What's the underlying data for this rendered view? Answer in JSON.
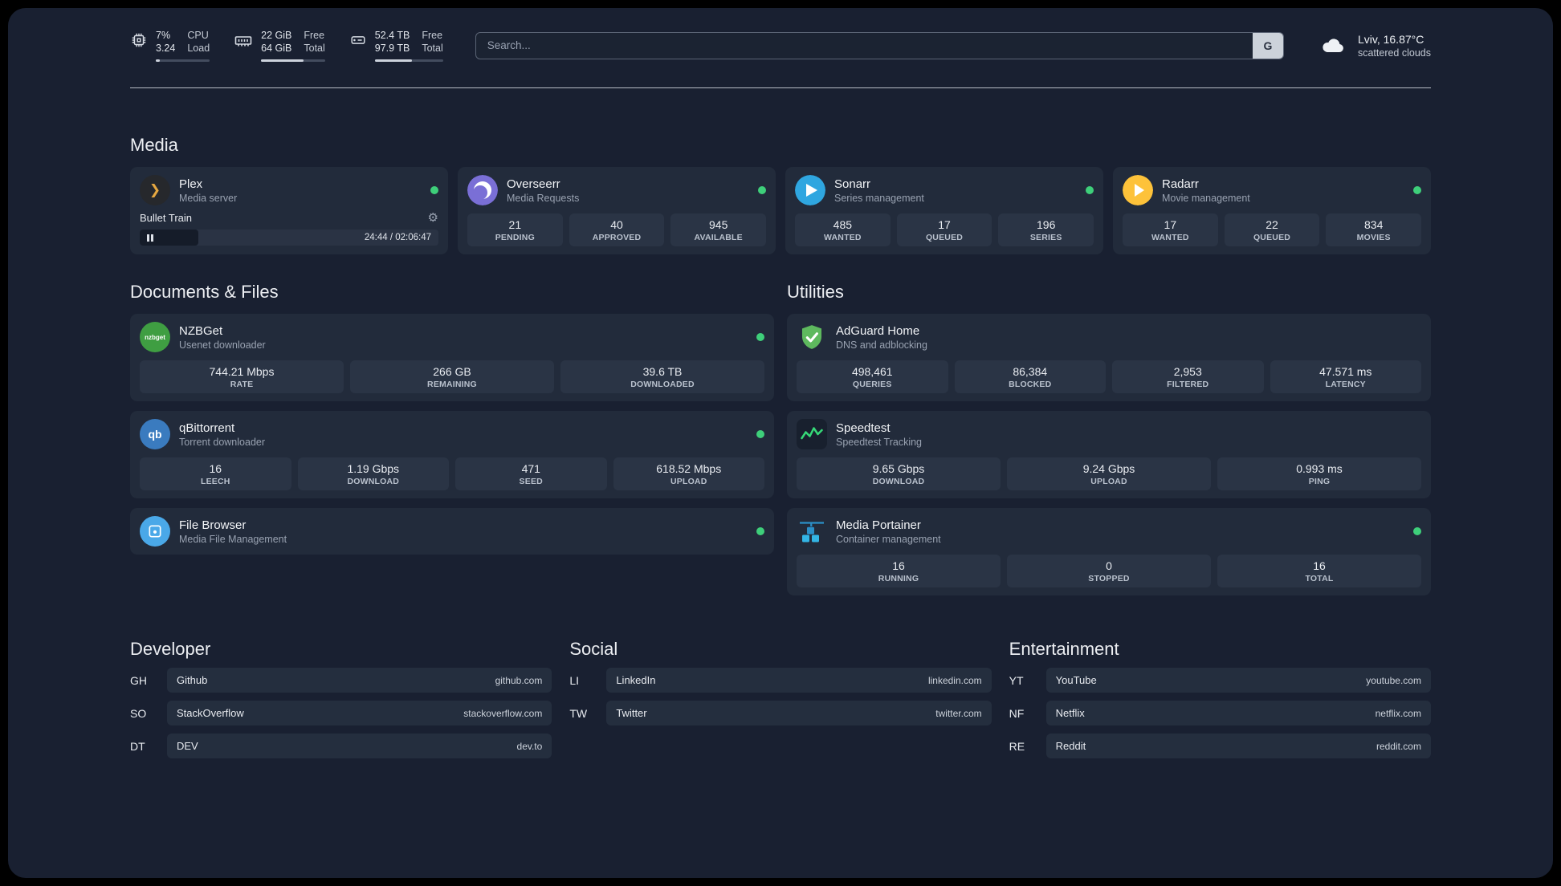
{
  "colors": {
    "status_online": "#3ecf7a",
    "accent_plex": "#e6a841",
    "accent_overseerr": "#7a6fd6",
    "accent_sonarr": "#2fa6e0",
    "accent_radarr": "#fdc23a",
    "accent_nzbget": "#3f9e42",
    "accent_adguard": "#5eb95e",
    "accent_qbittorrent": "#3a7bbf",
    "accent_speedtest": "#36d978",
    "accent_filebrowser": "#4aa8e8",
    "accent_portainer": "#33b5e5"
  },
  "icons": {
    "cpu": "cpu-chip",
    "ram": "memory-stick",
    "disk": "hard-drive",
    "weather": "cloud",
    "gear": "⚙",
    "plex_glyph": "❯",
    "status": "●"
  },
  "topbar": {
    "cpu": {
      "percent": "7%",
      "load": "3.24",
      "label_top": "CPU",
      "label_bottom": "Load",
      "bar_percent": 8
    },
    "ram": {
      "free": "22 GiB",
      "total": "64 GiB",
      "label_top": "Free",
      "label_bottom": "Total",
      "bar_percent": 66
    },
    "disk": {
      "free": "52.4 TB",
      "total": "97.9 TB",
      "label_top": "Free",
      "label_bottom": "Total",
      "bar_percent": 54
    },
    "search": {
      "placeholder": "Search...",
      "button": "G"
    },
    "weather": {
      "location": "Lviv, 16.87°C",
      "condition": "scattered clouds"
    }
  },
  "media": {
    "title": "Media",
    "plex": {
      "name": "Plex",
      "desc": "Media server",
      "player": {
        "title": "Bullet Train",
        "time": "24:44 / 02:06:47",
        "progress_percent": 19.5
      }
    },
    "overseerr": {
      "name": "Overseerr",
      "desc": "Media Requests",
      "stats": [
        {
          "value": "21",
          "label": "PENDING"
        },
        {
          "value": "40",
          "label": "APPROVED"
        },
        {
          "value": "945",
          "label": "AVAILABLE"
        }
      ]
    },
    "sonarr": {
      "name": "Sonarr",
      "desc": "Series management",
      "stats": [
        {
          "value": "485",
          "label": "WANTED"
        },
        {
          "value": "17",
          "label": "QUEUED"
        },
        {
          "value": "196",
          "label": "SERIES"
        }
      ]
    },
    "radarr": {
      "name": "Radarr",
      "desc": "Movie management",
      "stats": [
        {
          "value": "17",
          "label": "WANTED"
        },
        {
          "value": "22",
          "label": "QUEUED"
        },
        {
          "value": "834",
          "label": "MOVIES"
        }
      ]
    }
  },
  "documents": {
    "title": "Documents & Files",
    "nzbget": {
      "name": "NZBGet",
      "desc": "Usenet downloader",
      "logo_text": "nzbget",
      "stats": [
        {
          "value": "744.21 Mbps",
          "label": "RATE"
        },
        {
          "value": "266 GB",
          "label": "REMAINING"
        },
        {
          "value": "39.6 TB",
          "label": "DOWNLOADED"
        }
      ]
    },
    "qbittorrent": {
      "name": "qBittorrent",
      "desc": "Torrent downloader",
      "logo_text": "qb",
      "stats": [
        {
          "value": "16",
          "label": "LEECH"
        },
        {
          "value": "1.19 Gbps",
          "label": "DOWNLOAD"
        },
        {
          "value": "471",
          "label": "SEED"
        },
        {
          "value": "618.52 Mbps",
          "label": "UPLOAD"
        }
      ]
    },
    "filebrowser": {
      "name": "File Browser",
      "desc": "Media File Management"
    }
  },
  "utilities": {
    "title": "Utilities",
    "adguard": {
      "name": "AdGuard Home",
      "desc": "DNS and adblocking",
      "stats": [
        {
          "value": "498,461",
          "label": "QUERIES"
        },
        {
          "value": "86,384",
          "label": "BLOCKED"
        },
        {
          "value": "2,953",
          "label": "FILTERED"
        },
        {
          "value": "47.571 ms",
          "label": "LATENCY"
        }
      ]
    },
    "speedtest": {
      "name": "Speedtest",
      "desc": "Speedtest Tracking",
      "stats": [
        {
          "value": "9.65 Gbps",
          "label": "DOWNLOAD"
        },
        {
          "value": "9.24 Gbps",
          "label": "UPLOAD"
        },
        {
          "value": "0.993 ms",
          "label": "PING"
        }
      ]
    },
    "portainer": {
      "name": "Media Portainer",
      "desc": "Container management",
      "stats": [
        {
          "value": "16",
          "label": "RUNNING"
        },
        {
          "value": "0",
          "label": "STOPPED"
        },
        {
          "value": "16",
          "label": "TOTAL"
        }
      ]
    }
  },
  "bookmarks": {
    "developer": {
      "title": "Developer",
      "items": [
        {
          "abbr": "GH",
          "name": "Github",
          "url": "github.com"
        },
        {
          "abbr": "SO",
          "name": "StackOverflow",
          "url": "stackoverflow.com"
        },
        {
          "abbr": "DT",
          "name": "DEV",
          "url": "dev.to"
        }
      ]
    },
    "social": {
      "title": "Social",
      "items": [
        {
          "abbr": "LI",
          "name": "LinkedIn",
          "url": "linkedin.com"
        },
        {
          "abbr": "TW",
          "name": "Twitter",
          "url": "twitter.com"
        }
      ]
    },
    "entertainment": {
      "title": "Entertainment",
      "items": [
        {
          "abbr": "YT",
          "name": "YouTube",
          "url": "youtube.com"
        },
        {
          "abbr": "NF",
          "name": "Netflix",
          "url": "netflix.com"
        },
        {
          "abbr": "RE",
          "name": "Reddit",
          "url": "reddit.com"
        }
      ]
    }
  }
}
